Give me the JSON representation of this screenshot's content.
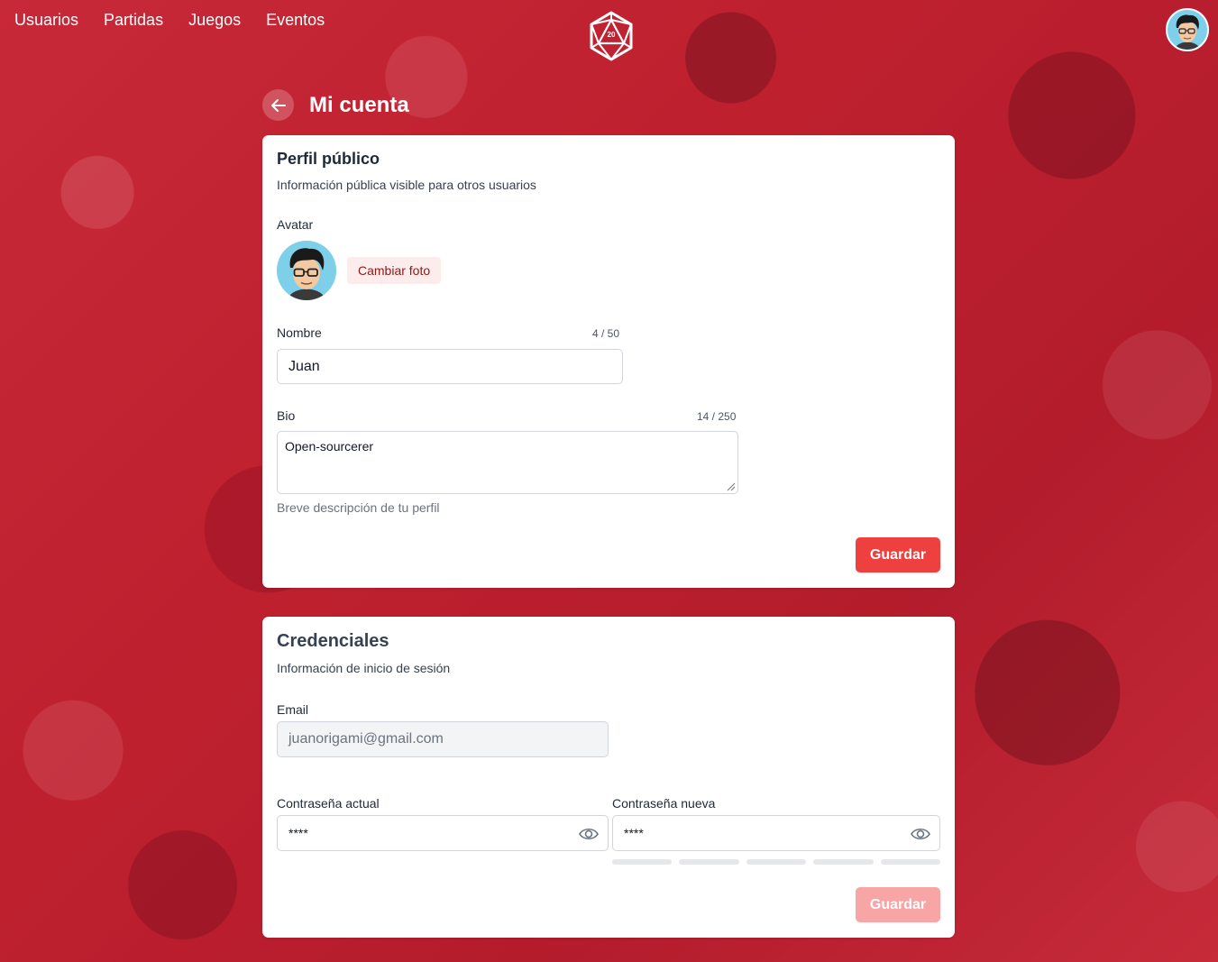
{
  "nav": {
    "links": [
      "Usuarios",
      "Partidas",
      "Juegos",
      "Eventos"
    ],
    "logo_icon": "d20-dice-icon",
    "logo_number": "20"
  },
  "header": {
    "title": "Mi cuenta"
  },
  "profile": {
    "title": "Perfil público",
    "subtitle": "Información pública visible para otros usuarios",
    "avatar_label": "Avatar",
    "change_photo": "Cambiar foto",
    "name_label": "Nombre",
    "name_counter": "4 / 50",
    "name_value": "Juan",
    "bio_label": "Bio",
    "bio_counter": "14 / 250",
    "bio_value": "Open-sourcerer",
    "bio_help": "Breve descripción de tu perfil",
    "save": "Guardar"
  },
  "credentials": {
    "title": "Credenciales",
    "subtitle": "Información de inicio de sesión",
    "email_label": "Email",
    "email_value": "juanorigami@gmail.com",
    "current_password_label": "Contraseña actual",
    "current_password_value": "****",
    "new_password_label": "Contraseña nueva",
    "new_password_value": "****",
    "save": "Guardar"
  },
  "colors": {
    "accent": "#ef4040",
    "accent_disabled": "#f8a5a5",
    "background": "#b9222f"
  }
}
